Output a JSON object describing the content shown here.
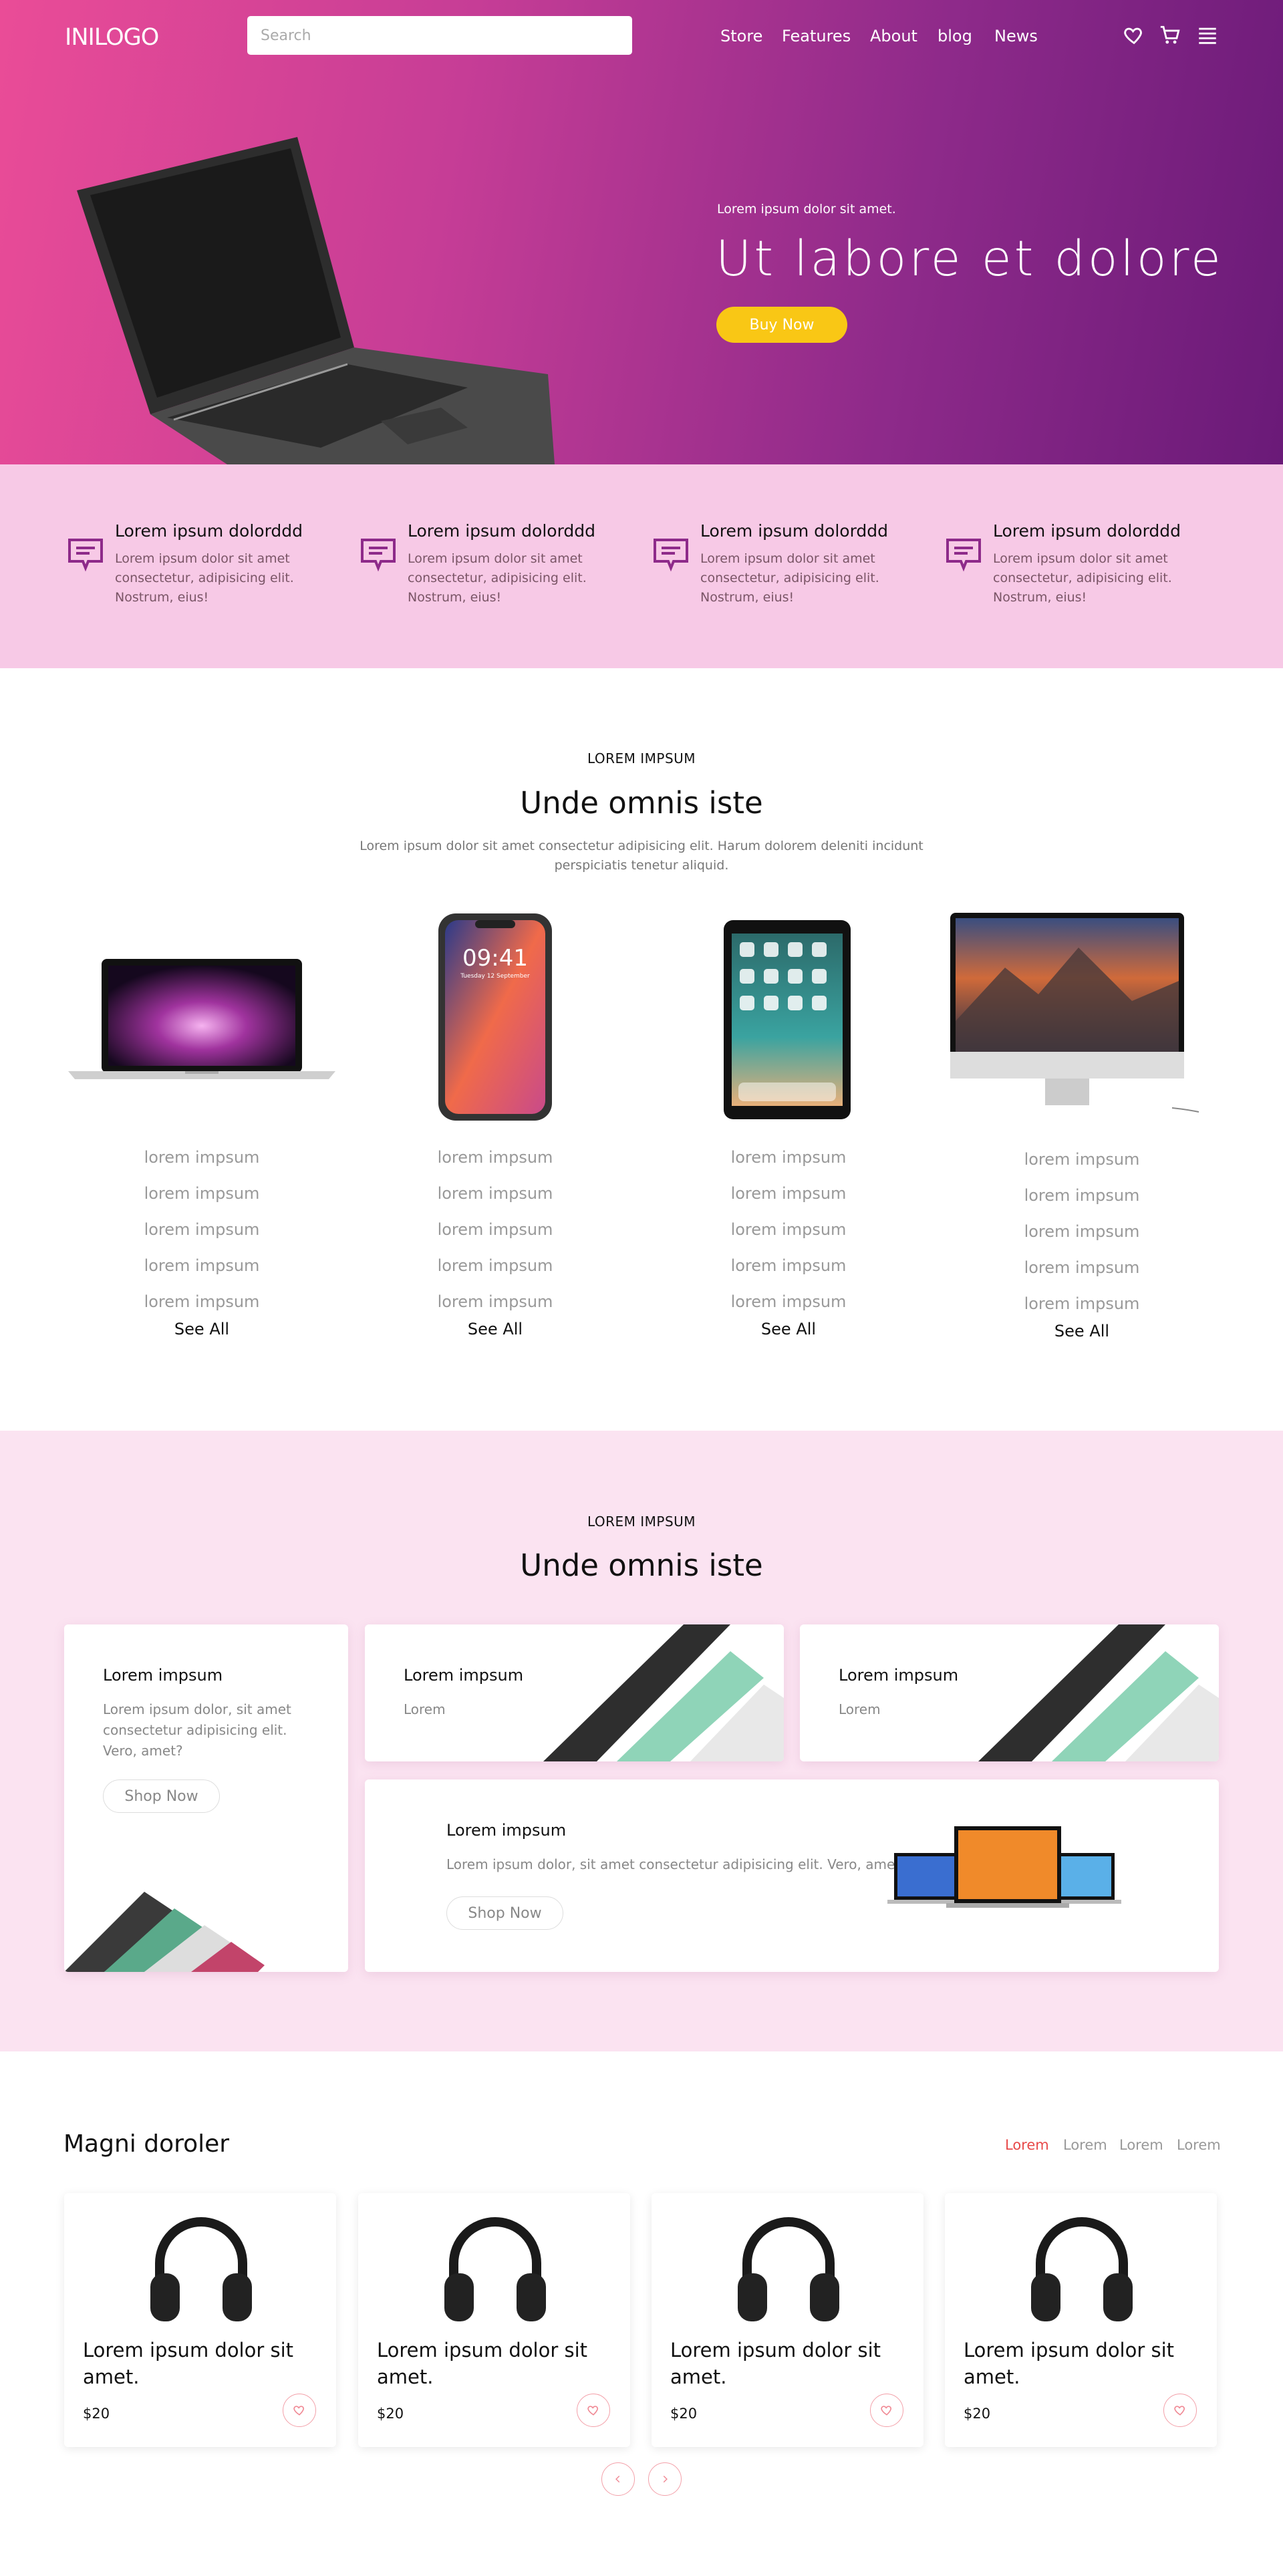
{
  "header": {
    "logo": "INILOGO",
    "search_placeholder": "Search",
    "nav": [
      "Store",
      "Features",
      "About",
      "blog",
      "News"
    ],
    "icons": [
      "heart-icon",
      "cart-icon",
      "menu-icon"
    ]
  },
  "hero": {
    "subtitle": "Lorem ipsum dolor sit amet.",
    "title": "Ut labore et dolore",
    "button": "Buy Now"
  },
  "features": [
    {
      "title": "Lorem ipsum dolorddd",
      "text": "Lorem ipsum dolor sit amet consectetur, adipisicing elit. Nostrum, eius!"
    },
    {
      "title": "Lorem ipsum dolorddd",
      "text": "Lorem ipsum dolor sit amet consectetur, adipisicing elit. Nostrum, eius!"
    },
    {
      "title": "Lorem ipsum dolorddd",
      "text": "Lorem ipsum dolor sit amet consectetur, adipisicing elit. Nostrum, eius!"
    },
    {
      "title": "Lorem ipsum dolorddd",
      "text": "Lorem ipsum dolor sit amet consectetur, adipisicing elit. Nostrum, eius!"
    }
  ],
  "categories": {
    "tag": "LOREM IMPSUM",
    "title": "Unde omnis iste",
    "description": "Lorem ipsum dolor sit amet consectetur adipisicing elit. Harum dolorem deleniti incidunt perspiciatis tenetur aliquid.",
    "products": [
      {
        "image": "laptop",
        "links": [
          "lorem impsum",
          "lorem impsum",
          "lorem impsum",
          "lorem impsum",
          "lorem impsum"
        ],
        "see_all": "See All"
      },
      {
        "image": "phone",
        "links": [
          "lorem impsum",
          "lorem impsum",
          "lorem impsum",
          "lorem impsum",
          "lorem impsum"
        ],
        "see_all": "See All"
      },
      {
        "image": "tablet",
        "links": [
          "lorem impsum",
          "lorem impsum",
          "lorem impsum",
          "lorem impsum",
          "lorem impsum"
        ],
        "see_all": "See All"
      },
      {
        "image": "desktop",
        "links": [
          "lorem impsum",
          "lorem impsum",
          "lorem impsum",
          "lorem impsum",
          "lorem impsum"
        ],
        "see_all": "See All"
      }
    ],
    "phone_time": "09:41",
    "phone_date": "Tuesday 12 September"
  },
  "promo": {
    "tag": "LOREM IMPSUM",
    "title": "Unde omnis iste",
    "card_tall": {
      "title": "Lorem impsum",
      "text": "Lorem ipsum dolor, sit amet consectetur adipisicing elit. Vero, amet?",
      "button": "Shop Now"
    },
    "card_mid": {
      "title": "Lorem impsum",
      "text": "Lorem"
    },
    "card_right": {
      "title": "Lorem impsum",
      "text": "Lorem"
    },
    "card_wide": {
      "title": "Lorem impsum",
      "text": "Lorem ipsum dolor, sit amet consectetur adipisicing elit. Vero, amet?",
      "button": "Shop Now"
    }
  },
  "shop": {
    "title": "Magni doroler",
    "tabs": [
      "Lorem",
      "Lorem",
      "Lorem",
      "Lorem"
    ],
    "active_tab_color": "#e84a4a",
    "items": [
      {
        "name": "Lorem ipsum dolor sit amet.",
        "price": "$20"
      },
      {
        "name": "Lorem ipsum dolor sit amet.",
        "price": "$20"
      },
      {
        "name": "Lorem ipsum dolor sit amet.",
        "price": "$20"
      },
      {
        "name": "Lorem ipsum dolor sit amet.",
        "price": "$20"
      }
    ]
  },
  "colors": {
    "accent": "#f9c715",
    "pink": "#f7c9e6",
    "purple": "#6a1a78"
  }
}
